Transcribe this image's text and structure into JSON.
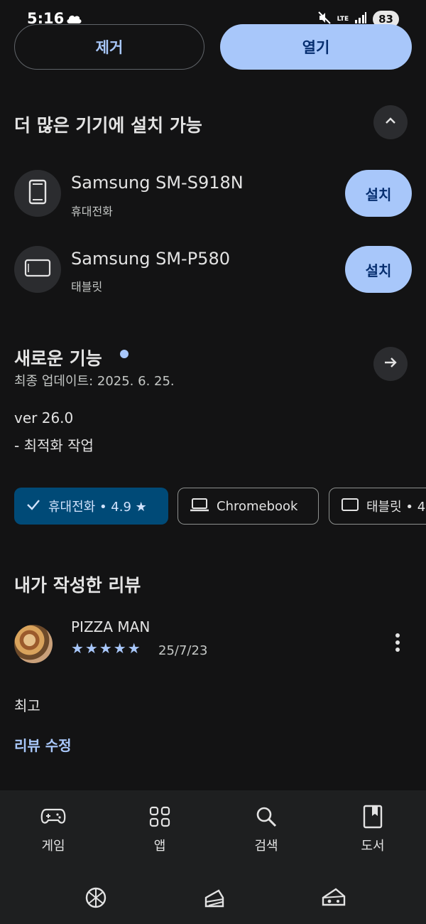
{
  "status": {
    "time": "5:16",
    "network": "LTE",
    "battery": "83"
  },
  "actions": {
    "remove": "제거",
    "open": "열기"
  },
  "install_section": {
    "title": "더 많은 기기에 설치 가능",
    "devices": [
      {
        "name": "Samsung SM-S918N",
        "type": "휴대전화",
        "button": "설치",
        "icon": "phone-icon"
      },
      {
        "name": "Samsung SM-P580",
        "type": "태블릿",
        "button": "설치",
        "icon": "tablet-icon"
      }
    ]
  },
  "whats_new": {
    "title": "새로운 기능",
    "updated": "최종 업데이트: 2025. 6. 25.",
    "version": "ver 26.0",
    "note": "- 최적화 작업"
  },
  "device_chips": [
    {
      "label": "휴대전화 • 4.9 ★",
      "selected": true,
      "icon": "check-icon"
    },
    {
      "label": "Chromebook",
      "selected": false,
      "icon": "laptop-icon"
    },
    {
      "label": "태블릿 • 4",
      "selected": false,
      "icon": "tablet-icon"
    }
  ],
  "my_review": {
    "title": "내가 작성한 리뷰",
    "author": "PIZZA MAN",
    "stars": "★★★★★",
    "rating": 5,
    "date": "25/7/23",
    "text": "최고",
    "edit": "리뷰 수정"
  },
  "bottom_nav": [
    {
      "label": "게임",
      "icon": "gamepad-icon"
    },
    {
      "label": "앱",
      "icon": "apps-grid-icon"
    },
    {
      "label": "검색",
      "icon": "search-icon"
    },
    {
      "label": "도서",
      "icon": "book-icon"
    }
  ],
  "colors": {
    "background": "#131314",
    "accent": "#a8c7fa",
    "chip_selected": "#004a77"
  }
}
